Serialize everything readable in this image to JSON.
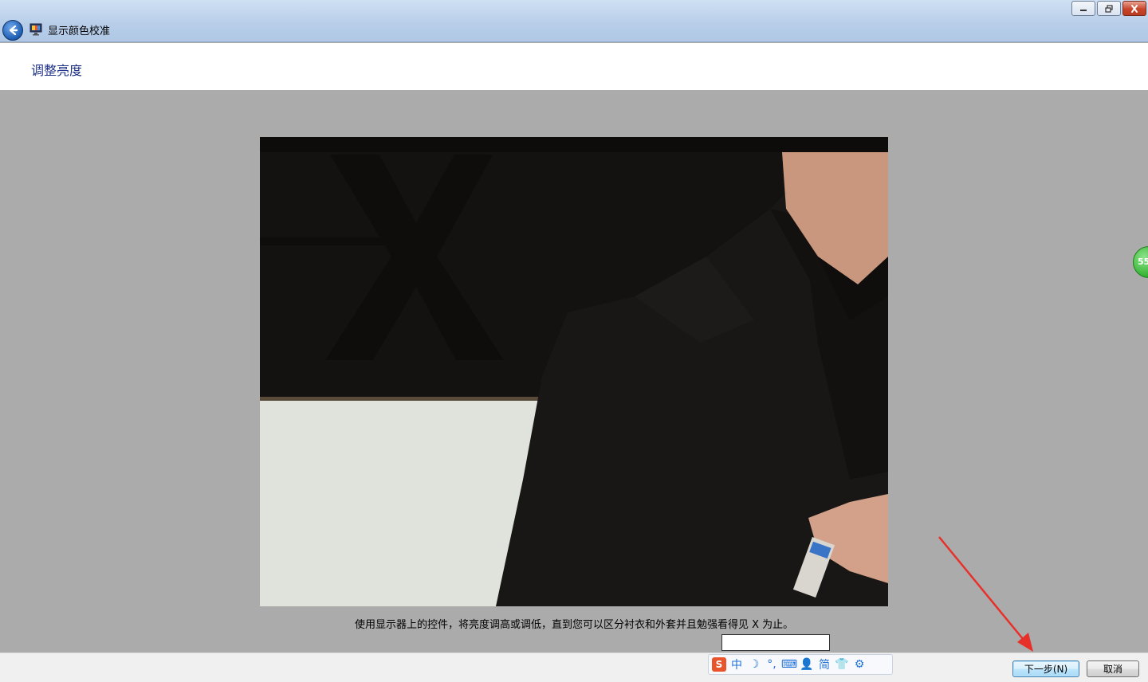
{
  "window": {
    "title": "显示颜色校准",
    "controls": [
      "minimize-icon",
      "restore-icon",
      "close-icon"
    ]
  },
  "page": {
    "heading": "调整亮度",
    "instruction": "使用显示器上的控件，将亮度调高或调低，直到您可以区分衬衣和外套并且勉强看得见 X 为止。"
  },
  "badge": {
    "text": "55"
  },
  "ime": {
    "logo": "S",
    "items": [
      {
        "name": "chinese-mode",
        "label": "中"
      },
      {
        "name": "moon-icon",
        "label": "☽"
      },
      {
        "name": "punctuation-icon",
        "label": "°,"
      },
      {
        "name": "keyboard-icon",
        "label": "⌨"
      },
      {
        "name": "user-icon",
        "label": "👤"
      },
      {
        "name": "simplified-mode",
        "label": "简"
      },
      {
        "name": "skin-icon",
        "label": "👕"
      },
      {
        "name": "settings-icon",
        "label": "⚙"
      }
    ]
  },
  "buttons": {
    "next": "下一步(N)",
    "cancel": "取消"
  },
  "colors": {
    "title_accent": "#1e3287",
    "annotation_arrow": "#e8302a"
  }
}
